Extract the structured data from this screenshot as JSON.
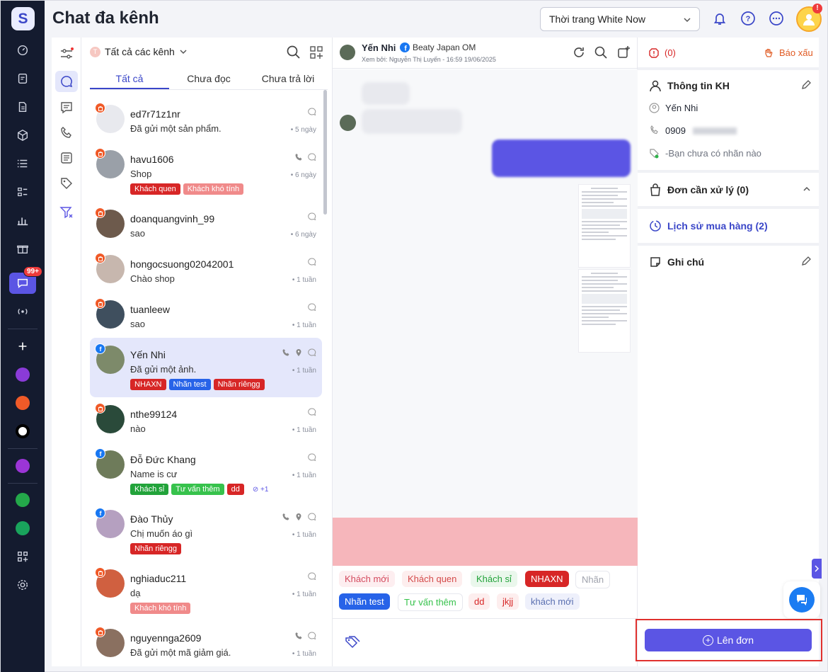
{
  "app": {
    "page_title": "Chat đa kênh",
    "logo_letter": "S",
    "nav_badge": "99+"
  },
  "header": {
    "shop_selector": "Thời trang White Now",
    "notif_badge": "!"
  },
  "conversations": {
    "channel_filter": "Tất cả các kênh",
    "channel_initial": "T",
    "tabs": [
      "Tất cả",
      "Chưa đọc",
      "Chưa trả lời"
    ],
    "items": [
      {
        "name": "ed7r71z1nr",
        "message": "Đã gửi một sản phẩm.",
        "time": "5 ngày",
        "platform": "shopee",
        "tags": []
      },
      {
        "name": "havu1606",
        "message": "Shop",
        "time": "6 ngày",
        "platform": "shopee",
        "tags": [
          {
            "label": "Khách quen",
            "color": "#d72626"
          },
          {
            "label": "Khách khó tính",
            "color": "#f08a8a"
          }
        ]
      },
      {
        "name": "doanquangvinh_99",
        "message": "sao",
        "time": "6 ngày",
        "platform": "shopee",
        "tags": []
      },
      {
        "name": "hongocsuong02042001",
        "message": "Chào shop",
        "time": "1 tuần",
        "platform": "shopee",
        "tags": []
      },
      {
        "name": "tuanleew",
        "message": "sao",
        "time": "1 tuần",
        "platform": "shopee",
        "tags": []
      },
      {
        "name": "Yến Nhi",
        "message": "Đã gửi một ảnh.",
        "time": "1 tuần",
        "platform": "facebook",
        "tags": [
          {
            "label": "NHAXN",
            "color": "#d72626"
          },
          {
            "label": "Nhãn test",
            "color": "#2763e8"
          },
          {
            "label": "Nhãn riêngg",
            "color": "#d72626"
          }
        ]
      },
      {
        "name": "nthe99124",
        "message": "nào",
        "time": "1 tuần",
        "platform": "shopee",
        "tags": []
      },
      {
        "name": "Đỗ Đức Khang",
        "message": "Name is cư",
        "time": "1 tuần",
        "platform": "facebook",
        "tags": [
          {
            "label": "Khách sỉ",
            "color": "#22a33a"
          },
          {
            "label": "Tư vấn thêm",
            "color": "#37c24c"
          },
          {
            "label": "dd",
            "color": "#d72626"
          }
        ],
        "more_tags": "+1"
      },
      {
        "name": "Đào Thủy",
        "message": "Chị muốn áo gì",
        "time": "1 tuần",
        "platform": "facebook",
        "tags": [
          {
            "label": "Nhãn riêngg",
            "color": "#d72626"
          }
        ]
      },
      {
        "name": "nghiaduc211",
        "message": "dạ",
        "time": "1 tuần",
        "platform": "shopee",
        "tags": [
          {
            "label": "Khách khó tính",
            "color": "#f08a8a"
          }
        ]
      },
      {
        "name": "nguyennga2609",
        "message": "Đã gửi một mã giảm giá.",
        "time": "1 tuần",
        "platform": "shopee",
        "tags": []
      }
    ]
  },
  "chat": {
    "customer_name": "Yến Nhi",
    "page_name": "Beaty Japan OM",
    "viewed_by": "Xem bởi: Nguyễn Thị Luyến - 16:59 19/06/2025",
    "quick_tags": [
      {
        "label": "Khách mới",
        "color": "#d44a5e",
        "bg": "#fdeef0"
      },
      {
        "label": "Khách quen",
        "color": "#d44a4a",
        "bg": "#fdeeee"
      },
      {
        "label": "Khách sỉ",
        "color": "#22a33a",
        "bg": "#eaf7ec"
      },
      {
        "label": "NHAXN",
        "color": "#ffffff",
        "bg": "#d72626"
      },
      {
        "label": "Nhãn",
        "color": "#a0a3ad",
        "bg": "#ffffff"
      },
      {
        "label": "Nhãn test",
        "color": "#ffffff",
        "bg": "#2763e8"
      },
      {
        "label": "Tư vấn thêm",
        "color": "#37c24c",
        "bg": "#ffffff"
      },
      {
        "label": "dd",
        "color": "#d72626",
        "bg": "#fdeeee"
      },
      {
        "label": "jkjj",
        "color": "#d72626",
        "bg": "#fdeeee"
      },
      {
        "label": "khách mới",
        "color": "#5a6fb0",
        "bg": "#eef0fb"
      }
    ]
  },
  "info": {
    "report_count": "(0)",
    "report_label": "Báo xấu",
    "section_customer": "Thông tin KH",
    "customer_name": "Yến Nhi",
    "phone_prefix": "0909",
    "no_label": "-Bạn chưa có nhãn nào",
    "section_orders": "Đơn cần xử lý (0)",
    "section_history": "Lịch sử mua hàng (2)",
    "section_notes": "Ghi chú",
    "create_order": "Lên đơn"
  },
  "colors": {
    "accent": "#5b55e4",
    "sidebar": "#141b2f",
    "danger": "#d72626",
    "highlight": "#e0312e"
  }
}
